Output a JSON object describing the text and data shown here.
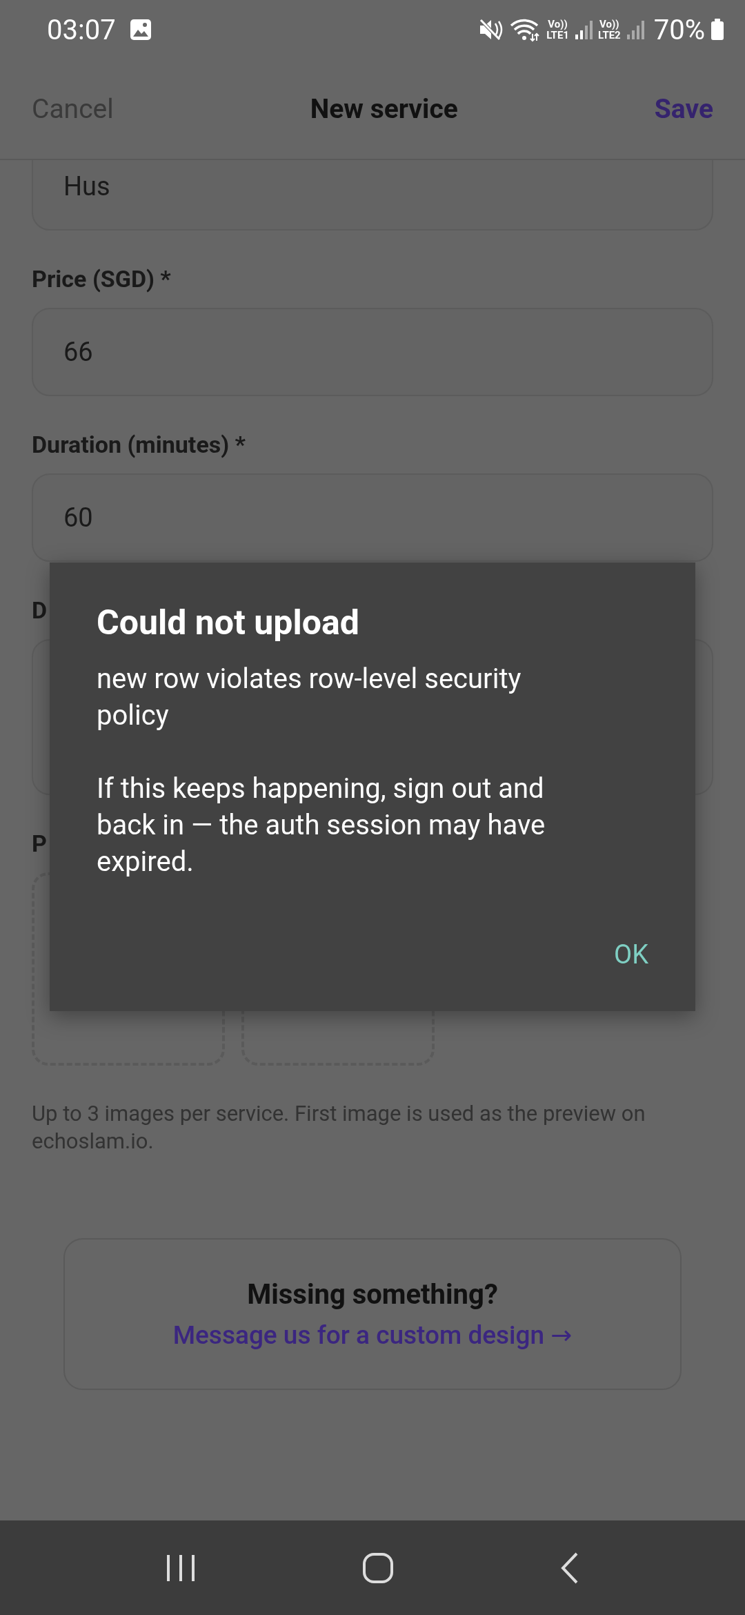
{
  "status_bar": {
    "time": "03:07",
    "volte_1": "Vo))",
    "sim_1": "LTE1",
    "volte_2": "Vo))",
    "sim_2": "LTE2",
    "battery": "70%"
  },
  "header": {
    "cancel": "Cancel",
    "title": "New service",
    "save": "Save"
  },
  "fields": [
    {
      "kind": "input",
      "value": "Hus"
    },
    {
      "kind": "input",
      "label": "Price (SGD) *",
      "value": "66"
    },
    {
      "kind": "input",
      "label": "Duration (minutes) *",
      "value": "60"
    },
    {
      "kind": "textarea",
      "label": "D"
    }
  ],
  "photos": {
    "label": "P"
  },
  "photos_hint": "Up to 3 images per service. First image is used as the preview on echoslam.io.",
  "help_card": {
    "title": "Missing something?",
    "link": "Message us for a custom design →"
  },
  "dialog": {
    "title": "Could not upload",
    "message": "new row violates row-level security policy",
    "hint": "If this keeps happening, sign out and back in — the auth session may have expired.",
    "button": "OK"
  }
}
